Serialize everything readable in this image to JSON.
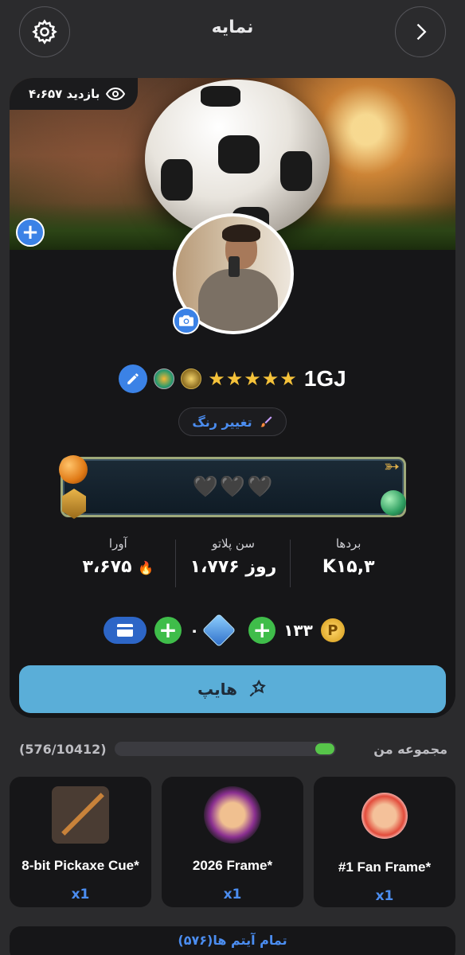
{
  "header": {
    "title": "نمایه",
    "settings_icon": "gear-icon",
    "back_icon": "chevron-right-icon"
  },
  "profile": {
    "views_label": "۴،۶۵۷ بازدید",
    "views_icon": "eye-icon",
    "username": "1GJ",
    "stars": "★★★★★",
    "change_color_label": "تغییر رنگ",
    "change_color_icon": "paintbrush-icon",
    "frame_hearts": "🖤🖤🖤"
  },
  "stats": [
    {
      "label": "بردها",
      "value": "K۱۵,۳"
    },
    {
      "label": "سن پلاتو",
      "value": "۱،۷۷۶ روز"
    },
    {
      "label": "آورا",
      "value": "۳،۶۷۵"
    }
  ],
  "currency": {
    "coins_value": "۱۳۳",
    "coin_symbol": "P",
    "gems_value": "۰"
  },
  "hype_button_label": "هایپ",
  "collection": {
    "label": "مجموعه من",
    "count": "(576/10412)",
    "progress_fraction": 0.0553
  },
  "items": [
    {
      "title": "#1 Fan Frame*",
      "qty": "x1"
    },
    {
      "title": "2026 Frame*",
      "qty": "x1"
    },
    {
      "title": "8-bit Pickaxe Cue*",
      "qty": "x1"
    }
  ],
  "all_items_label": "تمام آیتم ها(۵۷۶)",
  "colors": {
    "accent_blue": "#3b82e6",
    "link_blue": "#4b8df0",
    "hype_button": "#5aaed8",
    "plus_green": "#3fbd4a",
    "progress_green": "#57c54a"
  }
}
